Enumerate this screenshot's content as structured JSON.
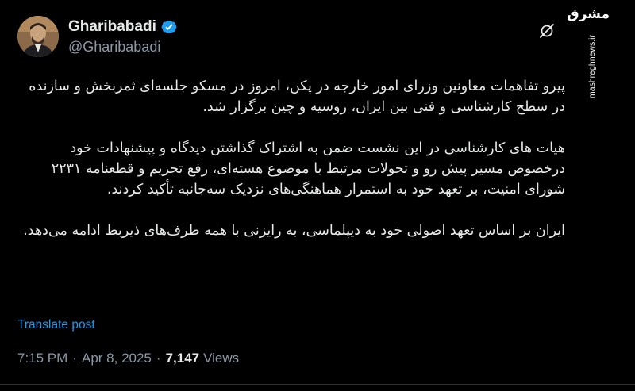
{
  "author": {
    "display_name": "Gharibabadi",
    "handle": "@Gharibabadi"
  },
  "icons": {
    "verified": "verified-badge-icon",
    "grok": "grok-icon",
    "avatar": "avatar"
  },
  "watermark": {
    "logo_text": "مشرق",
    "url": "mashreghnews.ir"
  },
  "post": {
    "paragraphs": [
      "پیرو تفاهمات معاونین وزرای امور خارجه در پکن، امروز در مسکو جلسه‌ای ثمربخش و سازنده در سطح کارشناسی و فنی بین ایران، روسیه و چین برگزار شد.",
      "هیات های کارشناسی در این نشست ضمن به اشتراک گذاشتن دیدگاه و پیشنهادات خود درخصوص مسیر پیش رو و تحولات مرتبط با موضوع هسته‌ای، رفع تحریم و قطعنامه ۲۲۳۱ شورای امنیت، بر تعهد خود به استمرار هماهنگی‌های نزدیک سه‌جانبه تأکید کردند.",
      "ایران بر اساس تعهد اصولی خود به دیپلماسی، به رایزنی با همه طرف‌های ذیربط ادامه می‌دهد."
    ],
    "translate_label": "Translate post",
    "time": "7:15 PM",
    "separator": "·",
    "date": "Apr 8, 2025",
    "views_count": "7,147",
    "views_label": "Views"
  },
  "colors": {
    "background": "#000000",
    "text": "#e7e9ea",
    "muted": "#8b98a5",
    "link": "#1d9bf0",
    "verified": "#1d9bf0"
  }
}
